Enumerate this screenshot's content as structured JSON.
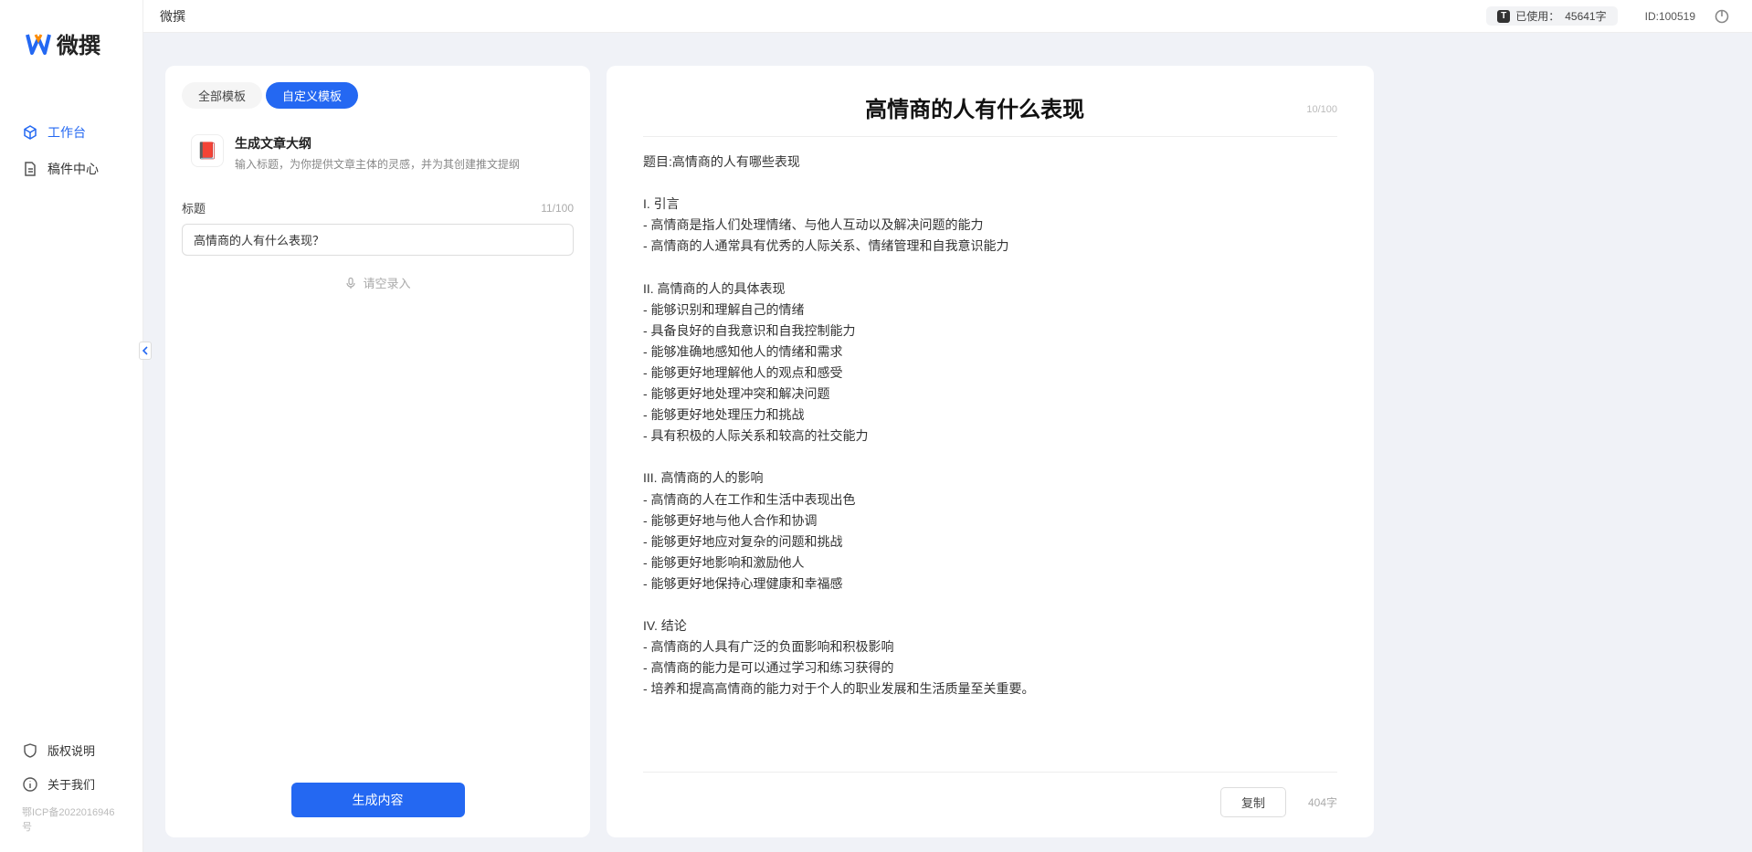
{
  "brand": {
    "name": "微撰"
  },
  "sidebar": {
    "nav": [
      {
        "label": "工作台",
        "active": true
      },
      {
        "label": "稿件中心",
        "active": false
      }
    ],
    "bottom": [
      {
        "label": "版权说明"
      },
      {
        "label": "关于我们"
      }
    ],
    "icp": "鄂ICP备2022016946号"
  },
  "topbar": {
    "title": "微撰",
    "usage_prefix": "已使用：",
    "usage_value": "45641字",
    "user_id": "ID:100519"
  },
  "tabs": {
    "all": "全部模板",
    "custom": "自定义模板"
  },
  "template": {
    "icon": "📕",
    "title": "生成文章大纲",
    "desc": "输入标题，为你提供文章主体的灵感，并为其创建推文提纲"
  },
  "form": {
    "title_label": "标题",
    "title_counter": "11/100",
    "title_value": "高情商的人有什么表现？",
    "voice_hint": "请空录入"
  },
  "actions": {
    "generate": "生成内容",
    "copy": "复制"
  },
  "output": {
    "title": "高情商的人有什么表现",
    "head_counter": "10/100",
    "word_count": "404字",
    "body": "题目:高情商的人有哪些表现\n\nI. 引言\n- 高情商是指人们处理情绪、与他人互动以及解决问题的能力\n- 高情商的人通常具有优秀的人际关系、情绪管理和自我意识能力\n\nII. 高情商的人的具体表现\n- 能够识别和理解自己的情绪\n- 具备良好的自我意识和自我控制能力\n- 能够准确地感知他人的情绪和需求\n- 能够更好地理解他人的观点和感受\n- 能够更好地处理冲突和解决问题\n- 能够更好地处理压力和挑战\n- 具有积极的人际关系和较高的社交能力\n\nIII. 高情商的人的影响\n- 高情商的人在工作和生活中表现出色\n- 能够更好地与他人合作和协调\n- 能够更好地应对复杂的问题和挑战\n- 能够更好地影响和激励他人\n- 能够更好地保持心理健康和幸福感\n\nIV. 结论\n- 高情商的人具有广泛的负面影响和积极影响\n- 高情商的能力是可以通过学习和练习获得的\n- 培养和提高高情商的能力对于个人的职业发展和生活质量至关重要。"
  }
}
